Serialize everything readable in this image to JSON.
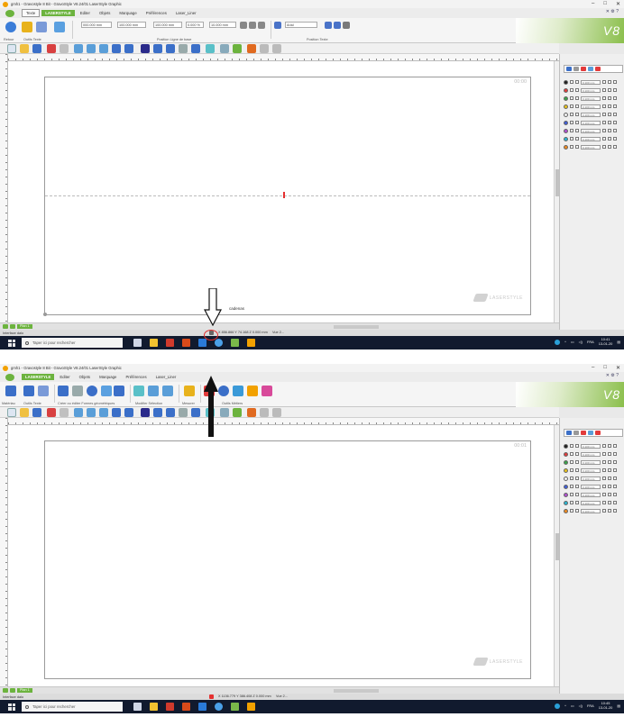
{
  "screenshots": [
    {
      "window": {
        "title": "gmh1 - Gravostyle 8 Bit - GravoStyle V8.24/01 LaserStyle Graphic",
        "controls": [
          "–",
          "□",
          "✕"
        ]
      },
      "menu": {
        "items": [
          "Texte",
          "LASERSTYLE",
          "Editer",
          "Objets",
          "Marquage",
          "Préférences",
          "Laser_Liner"
        ],
        "active": "Texte"
      },
      "ribbon": {
        "groups": [
          "Retour",
          "Outils Texte",
          "Position Ligne de base",
          "Position Texte"
        ],
        "fields": [
          "000.000 mm",
          "100.000 mm",
          "100.000 mm",
          "0.000 %",
          "10.000 mm",
          "Arial"
        ]
      },
      "canvas": {
        "timer": "00:00",
        "annotation": "cadenas",
        "watermark": "LASERSTYLE"
      },
      "bottom": {
        "page_tab": "Plan 1"
      },
      "status": {
        "left": "Interface dalo",
        "coords": "X 856.866  Y 74.168  Z 0.000 mm",
        "extra": "Vue 2..."
      },
      "taskbar": {
        "search_placeholder": "Taper ici pour rechercher",
        "lang": "FRA",
        "time": "10:41",
        "date": "13-01-20"
      }
    },
    {
      "window": {
        "title": "gmh1 - Gravostyle 8 Bit - GravoStyle V8.24/01 LaserStyle Graphic",
        "controls": [
          "–",
          "□",
          "✕"
        ]
      },
      "menu": {
        "items": [
          "LASERSTYLE",
          "Editer",
          "Objets",
          "Marquage",
          "Préférences",
          "Laser_Liner"
        ],
        "active": "LASERSTYLE"
      },
      "ribbon": {
        "groups": [
          "Matériau",
          "Outils Texte",
          "Créer ou éditer Formes géométriques",
          "Modifier Sélection",
          "Mesurer",
          "Outils Métiers"
        ]
      },
      "canvas": {
        "timer": "00:01",
        "watermark": "LASERSTYLE"
      },
      "bottom": {
        "page_tab": "Plan 1"
      },
      "status": {
        "left": "Interface dalo",
        "coords": "X 1136.779  Y 386.408  Z 0.000 mm",
        "extra": "Vue 2..."
      },
      "taskbar": {
        "search_placeholder": "Taper ici pour rechercher",
        "lang": "FRA",
        "time": "10:45",
        "date": "13-01-20"
      }
    }
  ],
  "layers": {
    "field_value": "0.100 mm",
    "colors": [
      "#202020",
      "#e23b3b",
      "#3aa34a",
      "#e8c21c",
      "#f2f2f2",
      "#3f5ed8",
      "#b04fd0",
      "#2ab6d3",
      "#ef8a1f"
    ]
  },
  "colors": {
    "brand_green": "#6cb33e",
    "taskbar": "#111a2e",
    "annotation_red": "#e23030"
  }
}
